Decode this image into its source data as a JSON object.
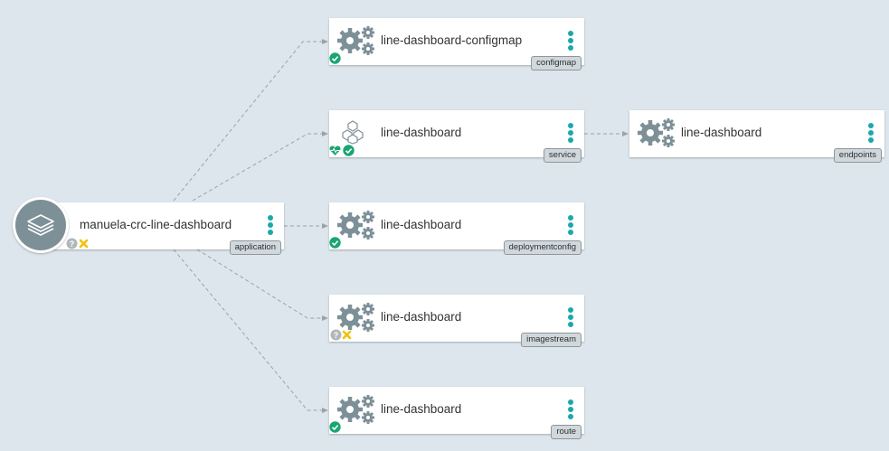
{
  "colors": {
    "background": "#dde6ec",
    "kebab": "#1aa8ac",
    "success": "#1aa572",
    "warning": "#f2c200",
    "unknown": "#b0b7bb",
    "icon_gray": "#7d9098",
    "edge": "#9aa3a8"
  },
  "application": {
    "title": "manuela-crc-line-dashboard",
    "kind": "application",
    "icon": "layers-icon",
    "status": [
      "unknown-icon",
      "warning-x-icon"
    ]
  },
  "nodes": [
    {
      "title": "line-dashboard-configmap",
      "kind": "configmap",
      "icon": "gears-icon",
      "status": [
        "success-check-icon"
      ]
    },
    {
      "title": "line-dashboard",
      "kind": "service",
      "icon": "cubes-icon",
      "status": [
        "heart-pulse-icon",
        "success-check-icon"
      ]
    },
    {
      "title": "line-dashboard",
      "kind": "deploymentconfig",
      "icon": "gears-icon",
      "status": [
        "success-check-icon"
      ]
    },
    {
      "title": "line-dashboard",
      "kind": "imagestream",
      "icon": "gears-icon",
      "status": [
        "unknown-icon",
        "warning-x-icon"
      ]
    },
    {
      "title": "line-dashboard",
      "kind": "route",
      "icon": "gears-icon",
      "status": [
        "success-check-icon"
      ]
    }
  ],
  "endpoints": {
    "title": "line-dashboard",
    "kind": "endpoints",
    "icon": "gears-icon"
  }
}
